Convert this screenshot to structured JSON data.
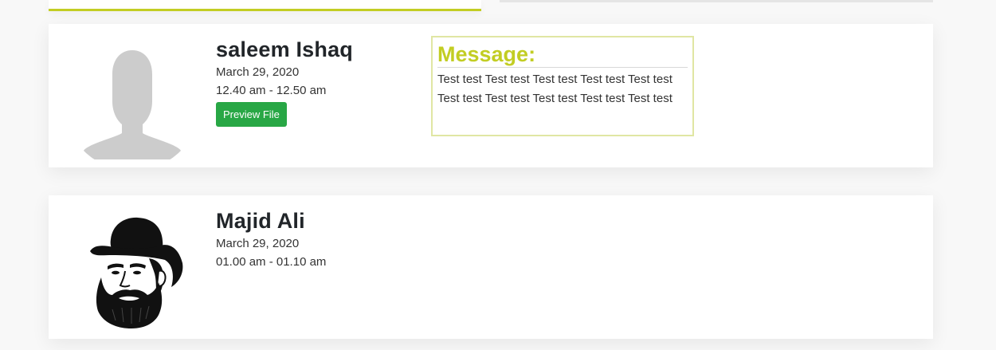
{
  "colors": {
    "accent": "#c2cd23",
    "button": "#28a745",
    "message_border": "#e0e6a3",
    "avatar_placeholder": "#cccccc"
  },
  "cards": [
    {
      "avatar_icon": "default-user-silhouette-icon",
      "name": "saleem Ishaq",
      "date": "March 29, 2020",
      "time": "12.40 am - 12.50 am",
      "button_label": "Preview File",
      "message_title": "Message:",
      "message_text": "Test test Test test Test test Test test Test test Test test Test test Test test Test test Test test"
    },
    {
      "avatar_icon": "bearded-man-hat-icon",
      "name": "Majid Ali",
      "date": "March 29, 2020",
      "time": "01.00 am - 01.10 am"
    }
  ]
}
